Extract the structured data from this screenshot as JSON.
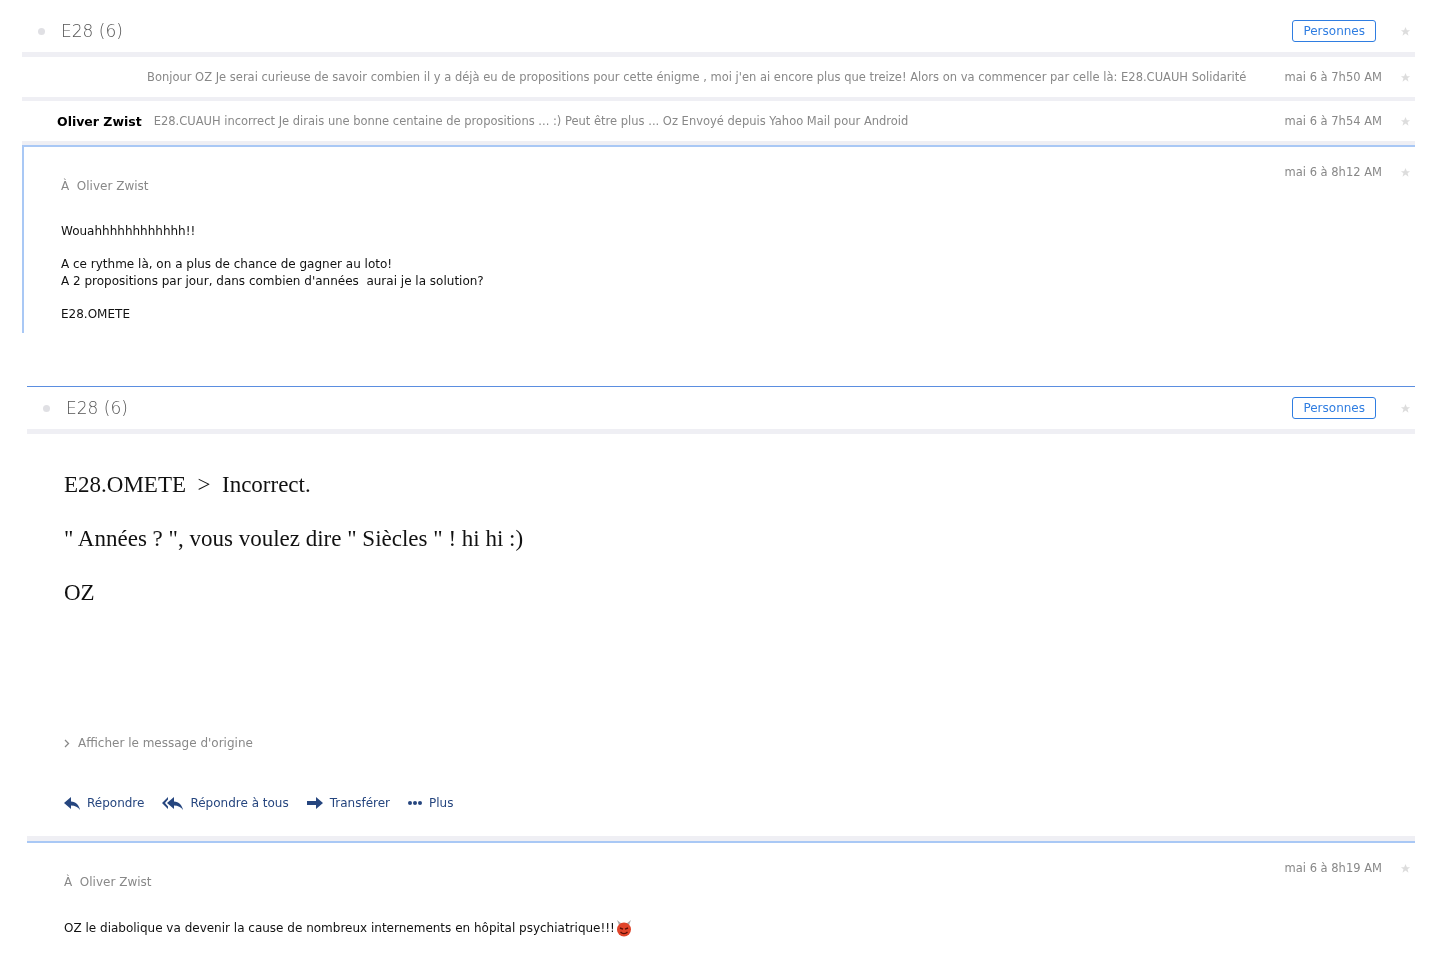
{
  "panes": [
    {
      "thread": {
        "title": "E28 (6)",
        "people_button": "Personnes"
      },
      "messages": [
        {
          "kind": "collapsed",
          "snippet": "Bonjour OZ Je serai curieuse de savoir combien il y a déjà eu de propositions pour cette énigme , moi j'en ai encore plus que treize! Alors on va commencer par celle là: E28.CUAUH Solidarité",
          "time": "mai 6 à 7h50 AM"
        },
        {
          "kind": "collapsed",
          "sender": "Oliver Zwist",
          "snippet": "E28.CUAUH incorrect Je dirais une bonne centaine de propositions ... :) Peut être plus ... Oz Envoyé depuis Yahoo Mail pour Android",
          "time": "mai 6 à 7h54 AM"
        },
        {
          "kind": "expanded",
          "time": "mai 6 à 8h12 AM",
          "to_label": "À",
          "to": "Oliver Zwist",
          "blocks": [
            [
              "Wouahhhhhhhhhhhh!!"
            ],
            [
              "A ce rythme là, on a plus de chance de gagner au loto!",
              "A 2 propositions par jour, dans combien d'années  aurai je la solution?"
            ],
            [
              "E28.OMETE"
            ]
          ]
        }
      ]
    },
    {
      "thread": {
        "title": "E28 (6)",
        "people_button": "Personnes"
      },
      "messages": [
        {
          "kind": "open",
          "blocks": [
            [
              "E28.OMETE  >  Incorrect."
            ],
            [
              "\" Années ? \", vous voulez dire \" Siècles \" ! hi hi :)"
            ],
            [
              "OZ"
            ]
          ],
          "show_original": "Afficher le message d'origine",
          "actions": [
            {
              "kind": "reply",
              "label": "Répondre"
            },
            {
              "kind": "reply_all",
              "label": "Répondre à tous"
            },
            {
              "kind": "forward",
              "label": "Transférer"
            },
            {
              "kind": "more",
              "label": "Plus"
            }
          ]
        },
        {
          "kind": "expanded",
          "time": "mai 6 à 8h19 AM",
          "to_label": "À",
          "to": "Oliver Zwist",
          "blocks": [
            [
              "OZ le diabolique va devenir la cause de nombreux internements en hôpital psychiatrique!!!"
            ]
          ],
          "trailing_emoji": true
        }
      ]
    }
  ]
}
